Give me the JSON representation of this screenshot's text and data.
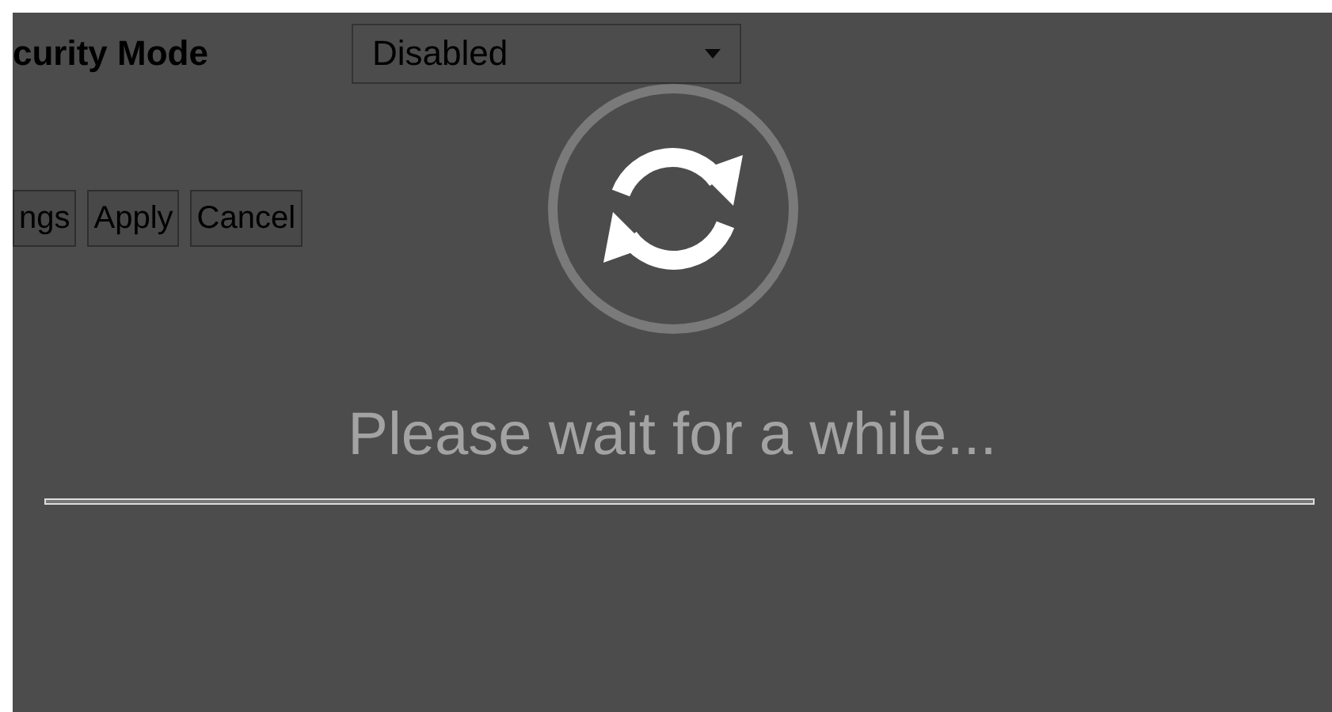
{
  "form": {
    "field_label": "curity Mode",
    "select": {
      "value": "Disabled"
    }
  },
  "buttons": [
    "ngs",
    "Apply",
    "Cancel"
  ],
  "overlay": {
    "message": "Please wait for a while..."
  }
}
